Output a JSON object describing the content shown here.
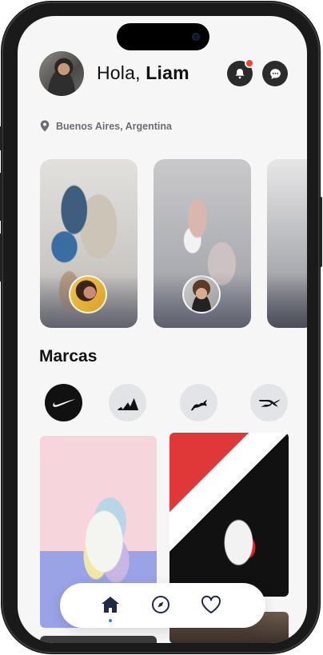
{
  "header": {
    "greeting_prefix": "Hola, ",
    "user_name": "Liam"
  },
  "location": {
    "text": "Buenos Aires, Argentina",
    "icon": "location-pin-icon"
  },
  "header_icons": {
    "notifications": "bell-icon",
    "messages": "chat-bubble-icon",
    "notification_dot_color": "#f0442f"
  },
  "brands": {
    "title": "Marcas",
    "items": [
      {
        "name": "nike-logo",
        "active": true
      },
      {
        "name": "adidas-logo",
        "active": false
      },
      {
        "name": "puma-logo",
        "active": false
      },
      {
        "name": "reebok-logo",
        "active": false
      }
    ]
  },
  "bottom_nav": {
    "items": [
      {
        "icon": "home-icon",
        "active": true
      },
      {
        "icon": "compass-icon",
        "active": false
      },
      {
        "icon": "heart-icon",
        "active": false
      }
    ],
    "active_indicator_color": "#3d7bd6"
  },
  "colors": {
    "background": "#f6f6f7",
    "text_primary": "#111111",
    "text_secondary": "#6b6d72",
    "icon_button_bg": "#2b2b2b",
    "brand_chip_bg": "#e3e4e7"
  }
}
